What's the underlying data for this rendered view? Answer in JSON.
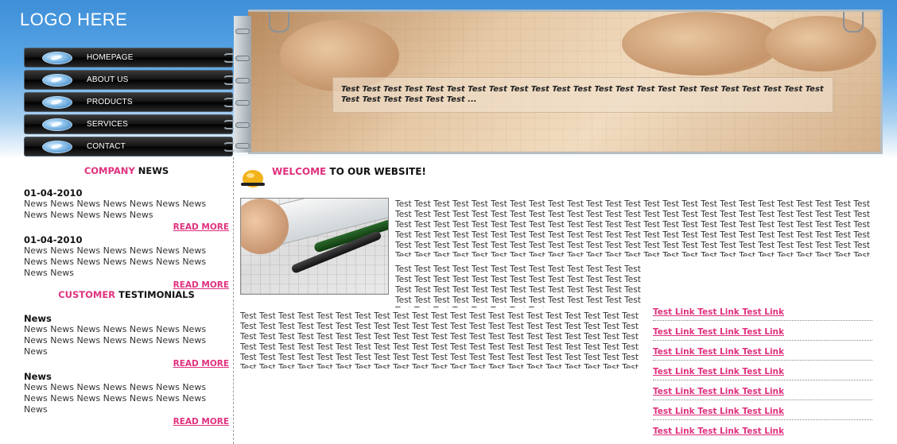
{
  "logo": {
    "text": "LOGO HERE"
  },
  "nav": {
    "items": [
      {
        "label": "HOMEPAGE"
      },
      {
        "label": "ABOUT US"
      },
      {
        "label": "PRODUCTS"
      },
      {
        "label": "SERVICES"
      },
      {
        "label": "CONTACT"
      }
    ]
  },
  "banner": {
    "caption": "Test Test Test Test Test Test Test Test Test Test Test Test Test Test Test Test Test Test Test Test Test Test Test Test Test Test Test Test Test ..."
  },
  "sidebar": {
    "news_title_accent": "COMPANY",
    "news_title_rest": " NEWS",
    "news": [
      {
        "date": "01-04-2010",
        "body": "News News News News News News News News News News News News",
        "read_more": "READ MORE"
      },
      {
        "date": "01-04-2010",
        "body": "News News News News News News News News News News News News News News News News",
        "read_more": "READ MORE"
      }
    ],
    "testimonials_title_accent": "CUSTOMER",
    "testimonials_title_rest": " TESTIMONIALS",
    "testimonials": [
      {
        "heading": "News",
        "body": "News News News News News News News News News News News News News News News",
        "read_more": "READ MORE"
      },
      {
        "heading": "News",
        "body": "News News News News News News News News News News News News News News News",
        "read_more": "READ MORE"
      }
    ]
  },
  "welcome": {
    "title_accent": "WELCOME",
    "title_rest": " TO OUR WEBSITE!"
  },
  "content": {
    "para1": "Test Test Test Test Test Test Test Test Test Test Test Test Test Test Test Test Test Test Test Test Test Test Test Test Test Test Test Test Test Test Test Test Test Test Test Test Test Test Test Test Test Test Test Test Test Test Test Test Test Test Test Test Test Test Test Test Test Test Test Test Test Test Test Test Test Test Test Test Test Test Test Test Test Test Test Test Test Test Test Test Test Test Test Test Test Test Test Test Test Test Test Test Test Test Test Test Test Test Test Test Test Test Test Test Test Test Test Test Test Test Test Test Test Test Test Test Test Test Test Test Test Test Test Test Test Test Test Test Test Test Test Test Test Test Test Test Test Test Test Test Test Test Test Test Test Test Test Test Test Test Test Test Test Test Test Test Test Test Test Test Test Test Test Test Test Test Test Test Test Test Test Test Test Test Test Test Test Test Test Test Test Test Test Test Test Test Test Test Test.",
    "para2": "Test Test Test Test Test Test Test Test Test Test Test Test Test Test Test Test Test Test Test Test Test Test Test Test Test Test Test Test Test Test Test Test Test Test Test Test Test Test Test Test Test Test Test Test Test Test Test Test Test Test Test Test Test Test Test Test Test Test Test Test",
    "para3": "Test Test Test Test Test Test Test Test Test Test Test Test Test Test Test Test Test Test Test Test Test Test Test Test Test Test Test Test Test Test Test Test Test Test Test Test Test Test Test Test Test Test Test Test Test Test Test Test Test Test Test Test Test Test Test Test Test Test Test Test Test Test Test Test Test Test Test Test Test Test Test Test Test Test Test Test Test Test Test Test Test Test Test Test Test Test Test Test Test Test Test Test Test Test Test Test Test Test Test Test Test Test Test Test Test Test Test Test Test Test Test Test Test Test Test Test Test Test Test Test Test Test Test Test Test Test Test Test."
  },
  "links": {
    "items": [
      "Test Link Test Link Test Link",
      "Test Link Test Link Test Link",
      "Test Link Test Link Test Link",
      "Test Link Test Link Test Link",
      "Test Link Test Link Test Link",
      "Test Link Test Link Test Link",
      "Test Link Test Link Test Link"
    ]
  },
  "colors": {
    "accent_pink": "#e0317e",
    "header_blue": "#3e8fd8"
  }
}
